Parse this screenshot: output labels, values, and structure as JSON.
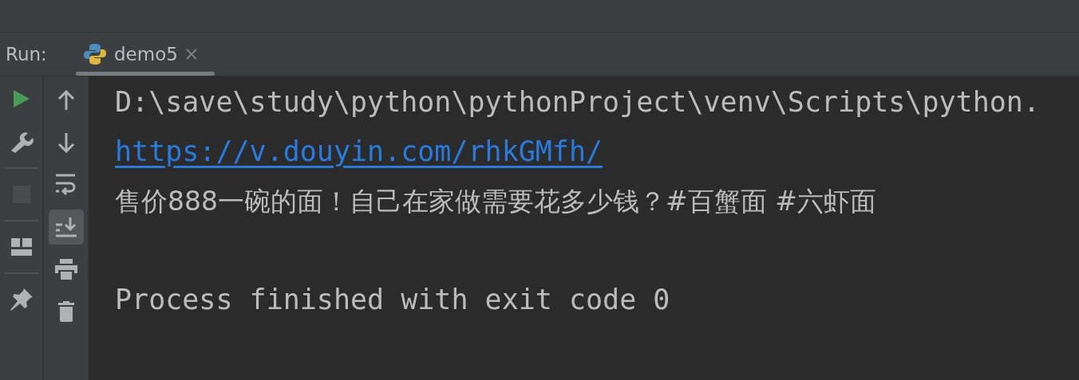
{
  "run_panel": {
    "label": "Run:",
    "tabs": [
      {
        "label": "demo5",
        "selected": true
      }
    ]
  },
  "left_toolbar": [
    {
      "kind": "run",
      "disabled": false
    },
    {
      "kind": "wrench",
      "disabled": false
    },
    {
      "kind": "stop",
      "disabled": true
    },
    {
      "kind": "layout",
      "disabled": false
    },
    {
      "kind": "pin",
      "disabled": false
    }
  ],
  "console_toolbar": [
    {
      "kind": "up",
      "on": false
    },
    {
      "kind": "down",
      "on": false
    },
    {
      "kind": "wrap",
      "on": false
    },
    {
      "kind": "scroll-end",
      "on": true
    },
    {
      "kind": "print",
      "on": false
    },
    {
      "kind": "trash",
      "on": false
    }
  ],
  "console": [
    {
      "kind": "text",
      "text": "D:\\save\\study\\python\\pythonProject\\venv\\Scripts\\python."
    },
    {
      "kind": "link",
      "text": "https://v.douyin.com/rhkGMfh/"
    },
    {
      "kind": "text",
      "text": "售价888一碗的面！自己在家做需要花多少钱？#百蟹面 #六虾面"
    },
    {
      "kind": "blank"
    },
    {
      "kind": "text",
      "text": "Process finished with exit code 0"
    }
  ]
}
